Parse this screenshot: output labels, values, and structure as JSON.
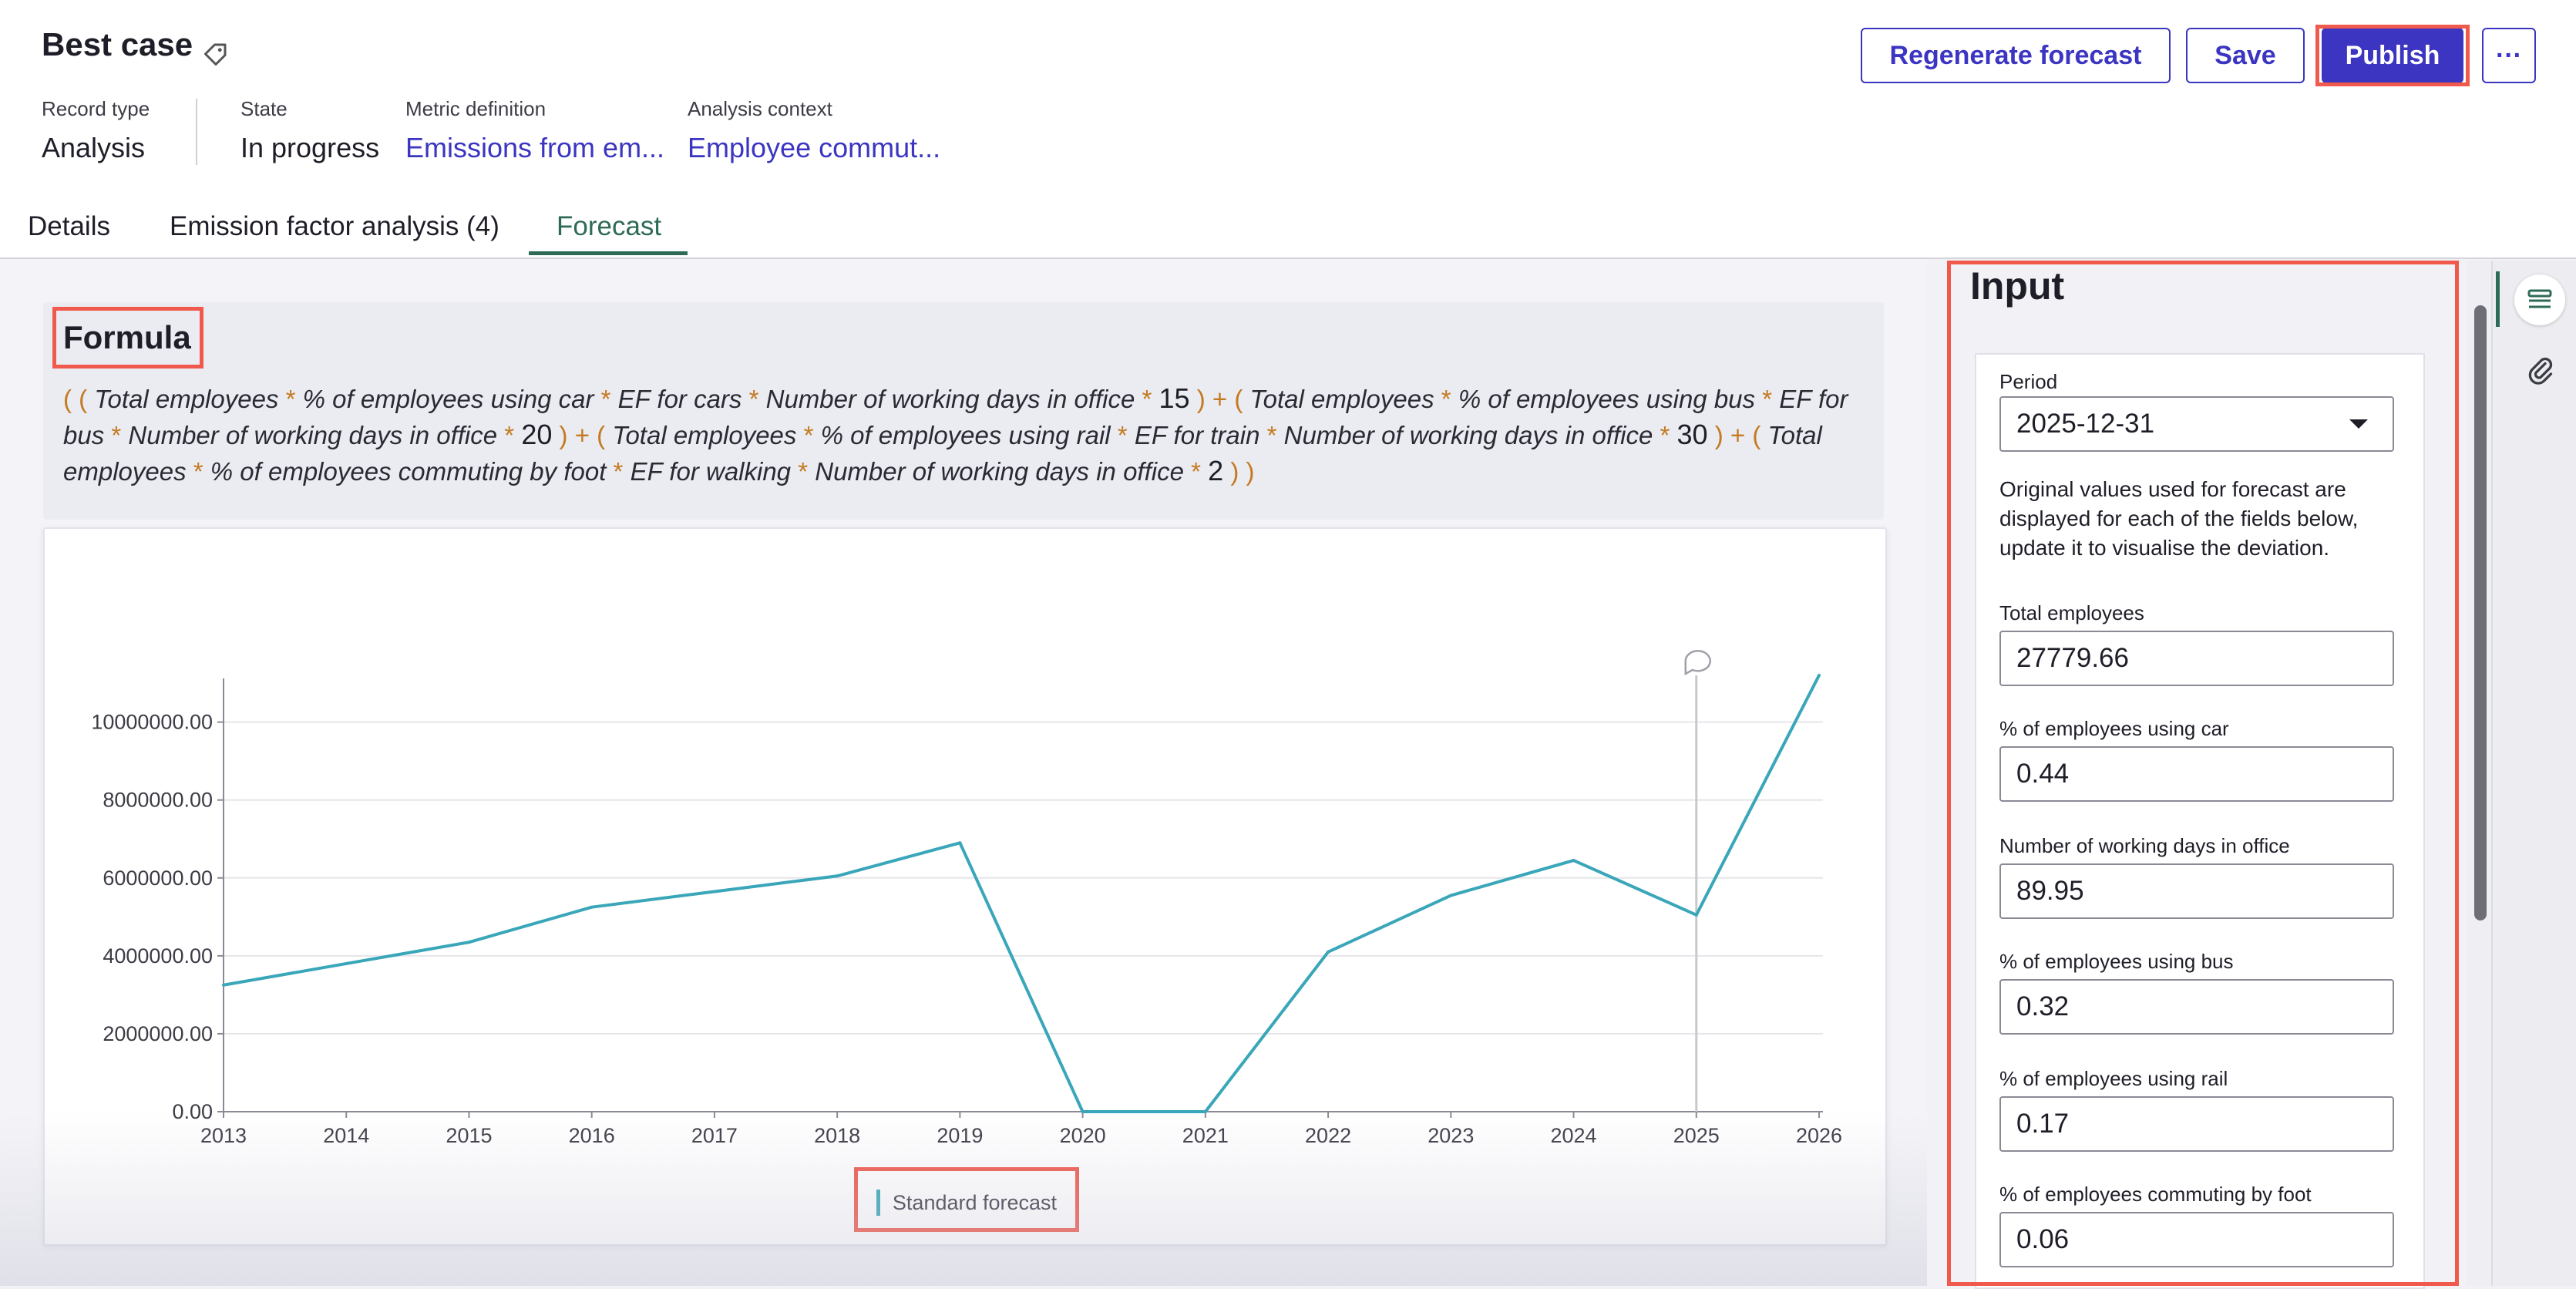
{
  "record": {
    "title": "Best case",
    "meta": [
      {
        "label": "Record type",
        "value": "Analysis"
      },
      {
        "label": "State",
        "value": "In progress"
      },
      {
        "label": "Metric definition",
        "value": "Emissions from em..."
      },
      {
        "label": "Analysis context",
        "value": "Employee commut..."
      }
    ]
  },
  "toolbar": {
    "regenerate_label": "Regenerate forecast",
    "save_label": "Save",
    "publish_label": "Publish",
    "more_label": "···"
  },
  "tabs": [
    {
      "label": "Details",
      "active": false
    },
    {
      "label": "Emission factor analysis (4)",
      "active": false
    },
    {
      "label": "Forecast",
      "active": true
    }
  ],
  "formula": {
    "title": "Formula",
    "terms": [
      {
        "vars": [
          "Total employees",
          "% of employees using car",
          "EF for cars",
          "Number of working days in office"
        ],
        "multiplier": "15"
      },
      {
        "vars": [
          "Total employees",
          "% of employees using bus",
          "EF for bus",
          "Number of working days in office"
        ],
        "multiplier": "20"
      },
      {
        "vars": [
          "Total employees",
          "% of employees using rail",
          "EF for train",
          "Number of working days in office"
        ],
        "multiplier": "30"
      },
      {
        "vars": [
          "Total employees",
          "% of employees commuting by foot",
          "EF for walking",
          "Number of working days in office"
        ],
        "multiplier": "2"
      }
    ]
  },
  "chart_data": {
    "type": "line",
    "title": "",
    "xlabel": "",
    "ylabel": "",
    "x": [
      "2013",
      "2014",
      "2015",
      "2016",
      "2017",
      "2018",
      "2019",
      "2020",
      "2021",
      "2022",
      "2023",
      "2024",
      "2025",
      "2026"
    ],
    "series": [
      {
        "name": "Standard forecast",
        "values": [
          3250000,
          3800000,
          4350000,
          5250000,
          5650000,
          6050000,
          6900000,
          0,
          0,
          4100000,
          5550000,
          6450000,
          5050000,
          11200000
        ]
      }
    ],
    "ylim": [
      0,
      11200000
    ],
    "yticks": [
      0,
      2000000,
      4000000,
      6000000,
      8000000,
      10000000
    ],
    "ytick_labels": [
      "0.00",
      "2000000.00",
      "4000000.00",
      "6000000.00",
      "8000000.00",
      "10000000.00"
    ],
    "marker_x": "2025",
    "grid": true,
    "legend": "bottom-center",
    "line_color": "#3aa6b9"
  },
  "input": {
    "title": "Input",
    "period_label": "Period",
    "period_value": "2025-12-31",
    "help": "Original values used for forecast are displayed for each of the fields below, update it to visualise the deviation.",
    "fields": [
      {
        "label": "Total employees",
        "value": "27779.66"
      },
      {
        "label": "% of employees using car",
        "value": "0.44"
      },
      {
        "label": "Number of working days in office",
        "value": "89.95"
      },
      {
        "label": "% of employees using bus",
        "value": "0.32"
      },
      {
        "label": "% of employees using rail",
        "value": "0.17"
      },
      {
        "label": "% of employees commuting by foot",
        "value": "0.06"
      }
    ]
  },
  "icons": {
    "tag": "tag-icon",
    "caret": "chevron-down-icon",
    "rail_panel": "panel-list-icon",
    "rail_attach": "paperclip-icon",
    "marker": "comment-icon"
  },
  "colors": {
    "brand": "#3b35c2",
    "highlight": "#ef5a4c",
    "tab_active": "#2e6b57",
    "series": "#3aa6b9",
    "formula_operator": "#c47a20"
  }
}
